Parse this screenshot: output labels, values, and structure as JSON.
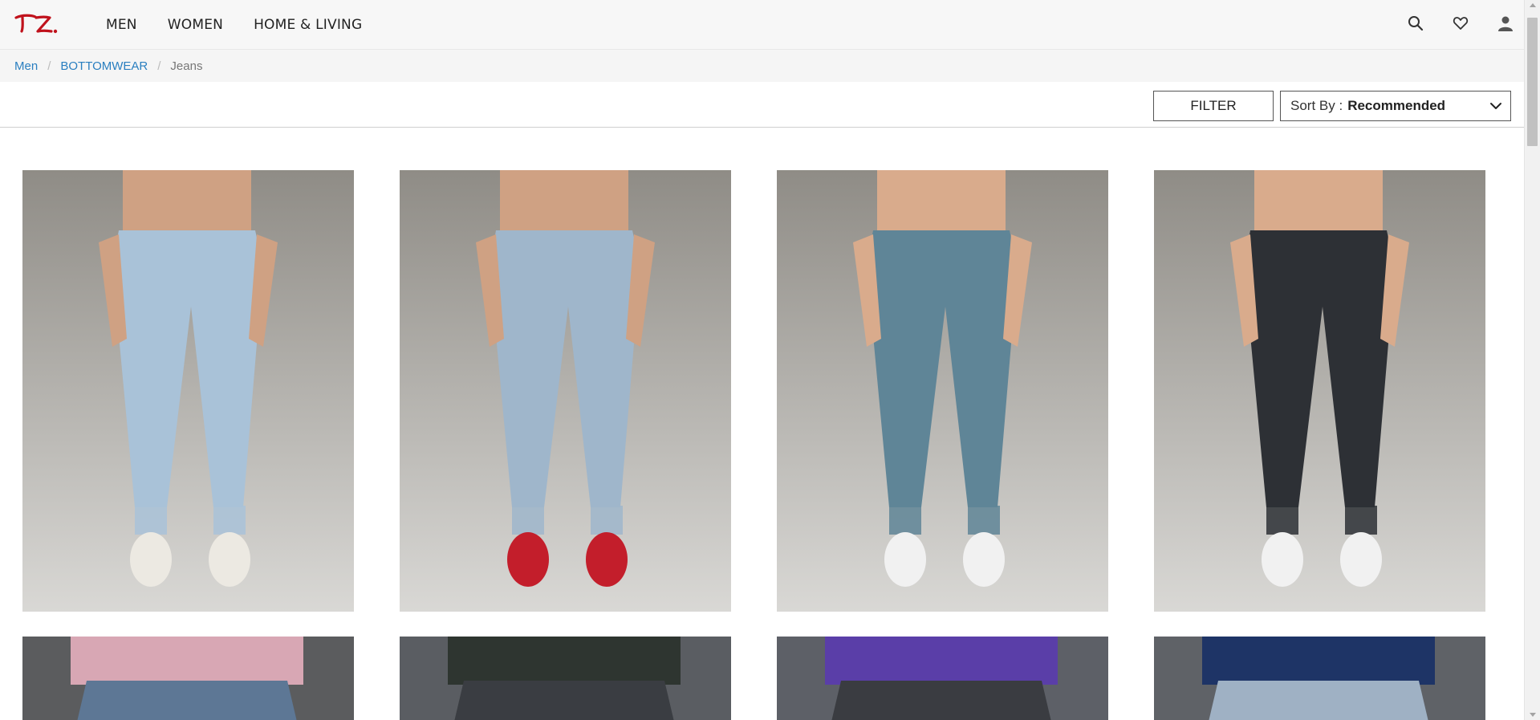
{
  "brand": {
    "logo_text": "TZ.",
    "logo_color": "#c0121c"
  },
  "nav": {
    "items": [
      "MEN",
      "WOMEN",
      "HOME & LIVING"
    ]
  },
  "header_icons": [
    "search-icon",
    "heart-icon",
    "user-icon"
  ],
  "breadcrumb": {
    "items": [
      "Men",
      "BOTTOMWEAR"
    ],
    "current": "Jeans"
  },
  "toolbar": {
    "filter_label": "FILTER",
    "sort_label": "Sort By :",
    "sort_value": "Recommended"
  },
  "products": [
    {
      "denim": "#a9c2d8",
      "backdrop": "#8f8c86",
      "shoe": "#ece9e2",
      "skin": "#cfa183"
    },
    {
      "denim": "#9fb6cb",
      "backdrop": "#7c7a76",
      "shoe": "#c31e2b",
      "skin": "#cfa183"
    },
    {
      "denim": "#5f8597",
      "backdrop": "#aeb0b2",
      "shoe": "#f1f1f1",
      "skin": "#d9ab8c"
    },
    {
      "denim": "#2d3035",
      "backdrop": "#a6a7ab",
      "shoe": "#f1f1f1",
      "skin": "#d9ab8c"
    },
    {
      "denim": "#5d7795",
      "backdrop": "#5b5c5e",
      "shirt": "#d8a7b4"
    },
    {
      "denim": "#3a3d42",
      "backdrop": "#5a5d62",
      "shirt": "#2e3530"
    },
    {
      "denim": "#3a3c41",
      "backdrop": "#5d6067",
      "shirt": "#5a3ea8"
    },
    {
      "denim": "#9fb1c4",
      "backdrop": "#5f6267",
      "shirt": "#1e3466"
    }
  ]
}
